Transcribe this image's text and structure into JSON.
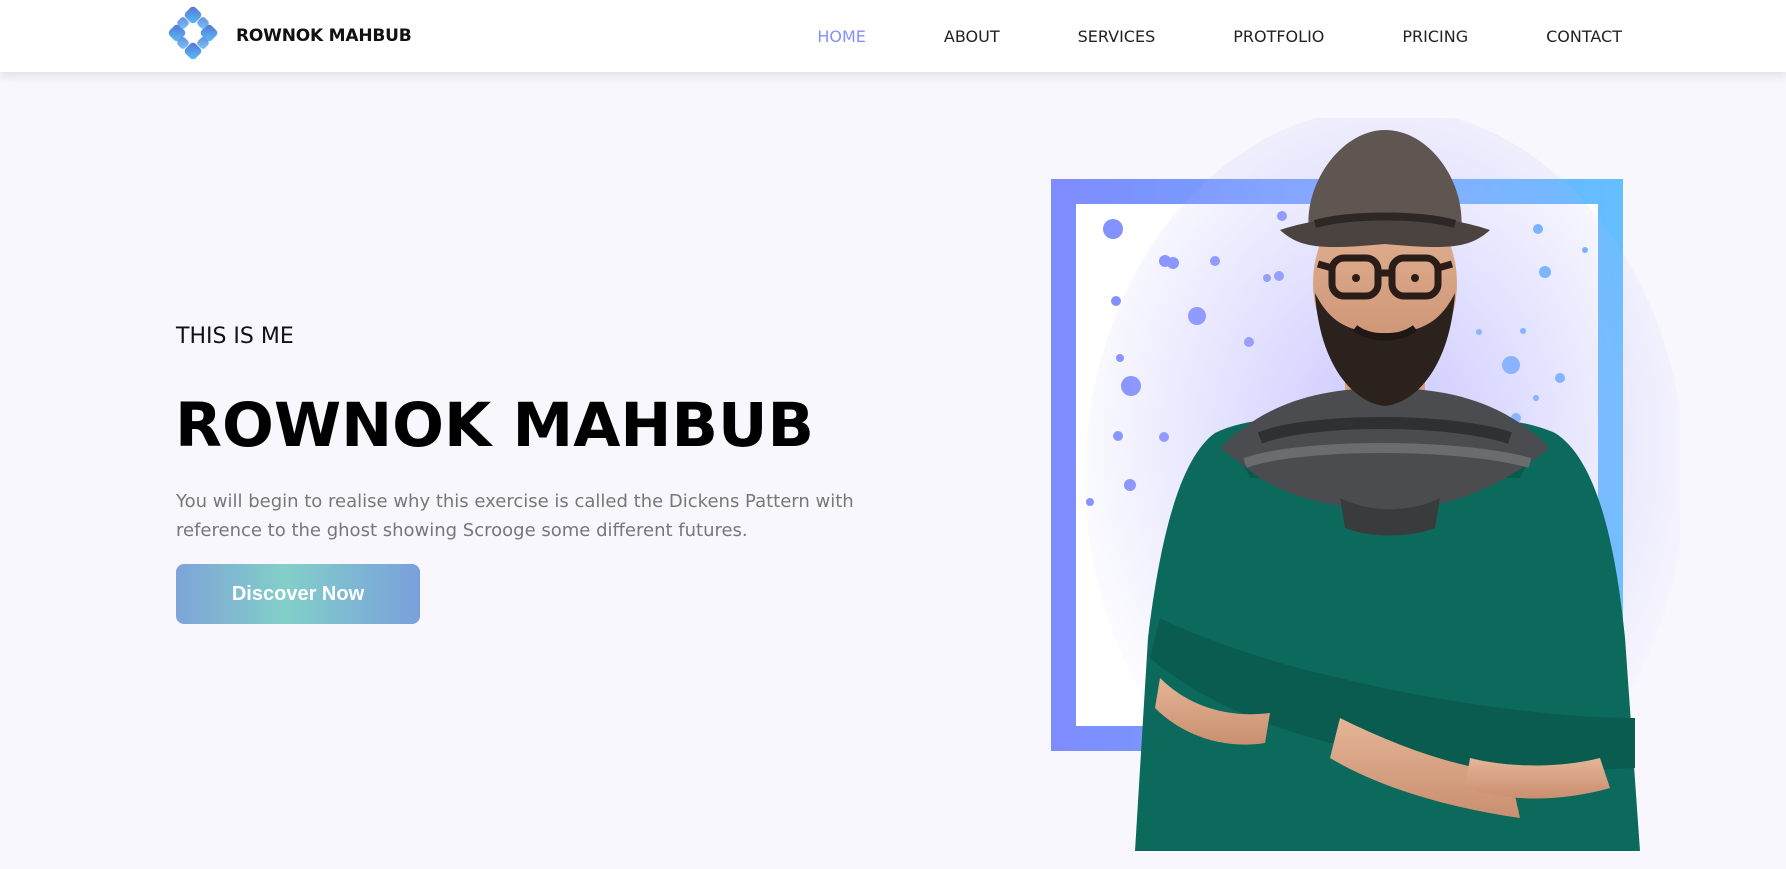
{
  "header": {
    "brand": {
      "name": "ROWNOK MAHBUB",
      "logo_icon": "interlocking-diamond-logo"
    },
    "nav": [
      {
        "label": "HOME",
        "active": true
      },
      {
        "label": "ABOUT",
        "active": false
      },
      {
        "label": "SERVICES",
        "active": false
      },
      {
        "label": "PROTFOLIO",
        "active": false
      },
      {
        "label": "PRICING",
        "active": false
      },
      {
        "label": "CONTACT",
        "active": false
      }
    ]
  },
  "hero": {
    "kicker": "THIS IS ME",
    "title": "ROWNOK MAHBUB",
    "description": "You will begin to realise why this exercise is called the Dickens Pattern with reference to the ghost showing Scrooge some different futures.",
    "cta_label": "Discover Now",
    "portrait_icon": "man-portrait-illustration"
  },
  "colors": {
    "accent": "#8490ff",
    "frame_gradient_start": "#7f8cff",
    "frame_gradient_end": "#64bfff",
    "page_background": "#f8f7fd",
    "sweater": "#0c6a5c"
  }
}
